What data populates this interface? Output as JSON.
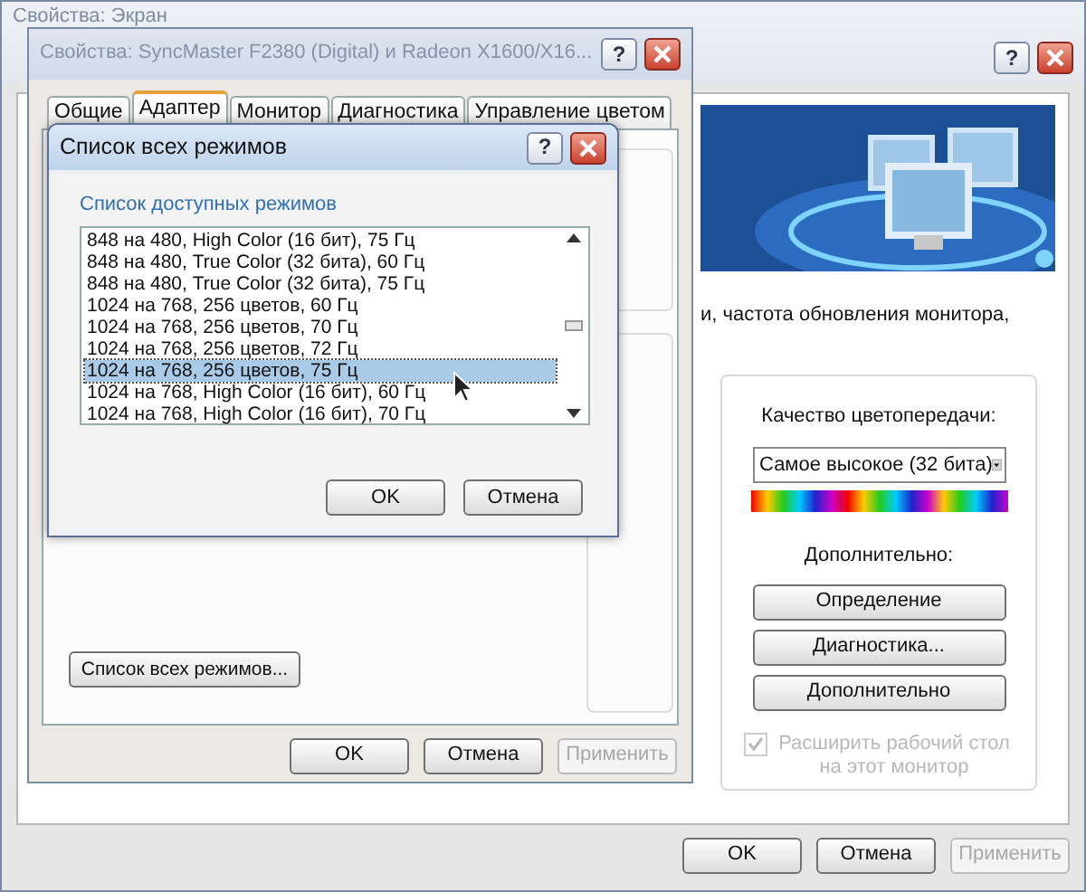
{
  "back_window": {
    "title": "Свойства: Экран",
    "help_glyph": "?",
    "description": "и, частота обновления монитора,",
    "color_quality": {
      "label": "Качество цветопередачи:",
      "value": "Самое высокое (32 бита)"
    },
    "advanced_label": "Дополнительно:",
    "buttons": [
      "Определение",
      "Диагностика...",
      "Дополнительно"
    ],
    "extend_checkbox": {
      "label": "Расширить рабочий стол на этот монитор",
      "checked": true,
      "disabled": true
    },
    "footer_buttons": [
      {
        "label": "OK",
        "disabled": false
      },
      {
        "label": "Отмена",
        "disabled": false
      },
      {
        "label": "Применить",
        "disabled": true
      }
    ]
  },
  "adapter_window": {
    "title": "Свойства: SyncMaster F2380 (Digital) и Radeon X1600/X16...",
    "help_glyph": "?",
    "tabs": [
      {
        "label": "Общие",
        "selected": false
      },
      {
        "label": "Адаптер",
        "selected": true
      },
      {
        "label": "Монитор",
        "selected": false
      },
      {
        "label": "Диагностика",
        "selected": false
      },
      {
        "label": "Управление цветом",
        "selected": false
      }
    ],
    "list_modes_button": "Список всех режимов...",
    "footer_buttons": [
      {
        "label": "OK",
        "disabled": false
      },
      {
        "label": "Отмена",
        "disabled": false
      },
      {
        "label": "Применить",
        "disabled": true
      }
    ]
  },
  "modes_dialog": {
    "title": "Список всех режимов",
    "help_glyph": "?",
    "list_label": "Список доступных режимов",
    "modes": [
      {
        "label": "848 на 480, High Color (16 бит), 75 Гц",
        "selected": false
      },
      {
        "label": "848 на 480, True Color (32 бита), 60 Гц",
        "selected": false
      },
      {
        "label": "848 на 480, True Color (32 бита), 75 Гц",
        "selected": false
      },
      {
        "label": "1024 на 768, 256 цветов, 60 Гц",
        "selected": false
      },
      {
        "label": "1024 на 768, 256 цветов, 70 Гц",
        "selected": false
      },
      {
        "label": "1024 на 768, 256 цветов, 72 Гц",
        "selected": false
      },
      {
        "label": "1024 на 768, 256 цветов, 75 Гц",
        "selected": true
      },
      {
        "label": "1024 на 768, High Color (16 бит), 60 Гц",
        "selected": false
      },
      {
        "label": "1024 на 768, High Color (16 бит), 70 Гц",
        "selected": false
      }
    ],
    "footer_buttons": [
      {
        "label": "OK",
        "disabled": false
      },
      {
        "label": "Отмена",
        "disabled": false
      }
    ]
  }
}
